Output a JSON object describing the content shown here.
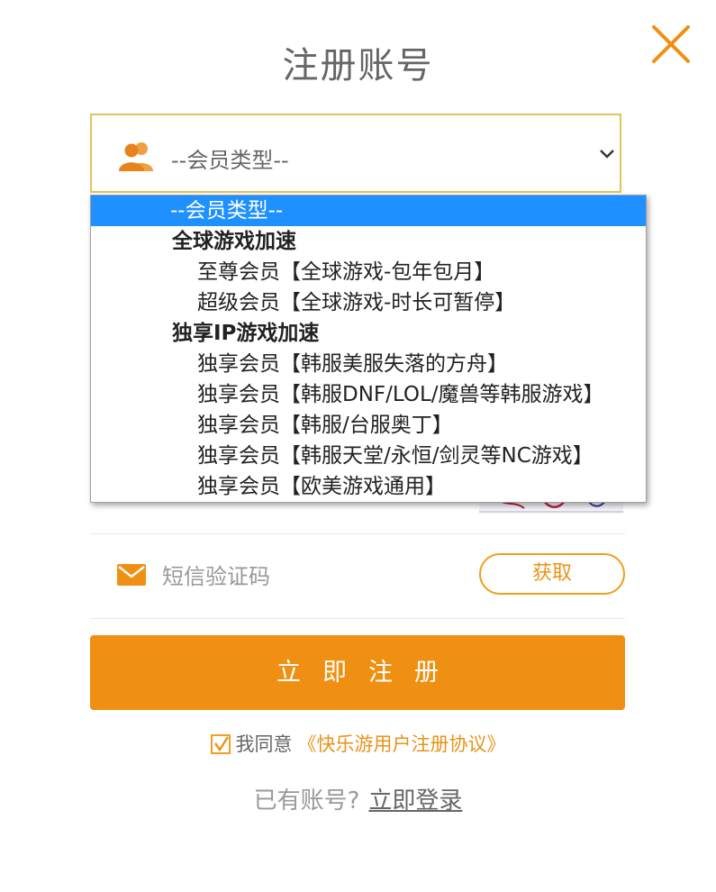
{
  "header": {
    "title": "注册账号"
  },
  "member_type_select": {
    "selected_label": "--会员类型--",
    "options": [
      {
        "label": "--会员类型--",
        "kind": "option",
        "selected": true
      },
      {
        "label": "全球游戏加速",
        "kind": "group"
      },
      {
        "label": "至尊会员【全球游戏-包年包月】",
        "kind": "option"
      },
      {
        "label": "超级会员【全球游戏-时长可暂停】",
        "kind": "option"
      },
      {
        "label": "独享IP游戏加速",
        "kind": "group"
      },
      {
        "label": "独享会员【韩服美服失落的方舟】",
        "kind": "option"
      },
      {
        "label": "独享会员【韩服DNF/LOL/魔兽等韩服游戏】",
        "kind": "option"
      },
      {
        "label": "独享会员【韩服/台服奥丁】",
        "kind": "option"
      },
      {
        "label": "独享会员【韩服天堂/永恒/剑灵等NC游戏】",
        "kind": "option"
      },
      {
        "label": "独享会员【欧美游戏通用】",
        "kind": "option"
      }
    ]
  },
  "sms": {
    "placeholder": "短信验证码",
    "value": "",
    "get_code_label": "获取"
  },
  "register_button_label": "立即注册",
  "agreement": {
    "checked": true,
    "agree_text": "我同意",
    "link_text": "《快乐游用户注册协议》"
  },
  "login": {
    "prompt": "已有账号?",
    "link_text": "立即登录"
  },
  "colors": {
    "accent": "#f09012",
    "select_border": "#e3c35a",
    "selected_option_bg": "#1e90ff",
    "title_text": "#666666"
  },
  "icons": {
    "close": "close-icon",
    "member_type": "users-icon",
    "dropdown": "chevron-down-icon",
    "sms": "mail-icon",
    "checkbox": "check-icon"
  }
}
